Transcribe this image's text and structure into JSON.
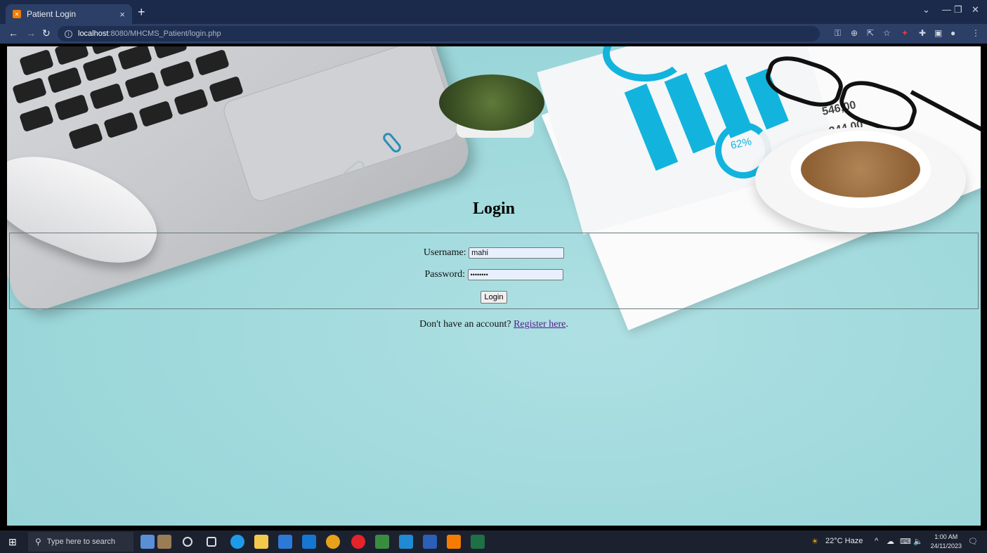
{
  "browser": {
    "tab_title": "Patient Login",
    "tab_close": "×",
    "new_tab": "+",
    "url_host": "localhost",
    "url_rest": ":8080/MHCMS_Patient/login.php"
  },
  "page": {
    "heading": "Login",
    "username_label": "Username:",
    "username_value": "mahi",
    "password_label": "Password:",
    "password_value": "••••••••",
    "login_button": "Login",
    "register_prompt": "Don't have an account?",
    "register_link": "Register here",
    "register_period": "."
  },
  "taskbar": {
    "search_placeholder": "Type here to search",
    "weather": "22°C  Haze",
    "time": "1:00 AM",
    "date": "24/11/2023"
  },
  "colors": {
    "accent": "#12b4dd",
    "page_bg": "#9fd9dc",
    "chrome": "#2c3f66",
    "link": "#551a8b"
  },
  "icons": [
    "back-arrow-icon",
    "forward-arrow-icon",
    "reload-icon",
    "info-icon",
    "key-icon",
    "zoom-icon",
    "share-icon",
    "star-icon",
    "extensions-icon",
    "sidepanel-icon",
    "profile-icon",
    "menu-icon",
    "windows-start-icon",
    "search-icon"
  ]
}
